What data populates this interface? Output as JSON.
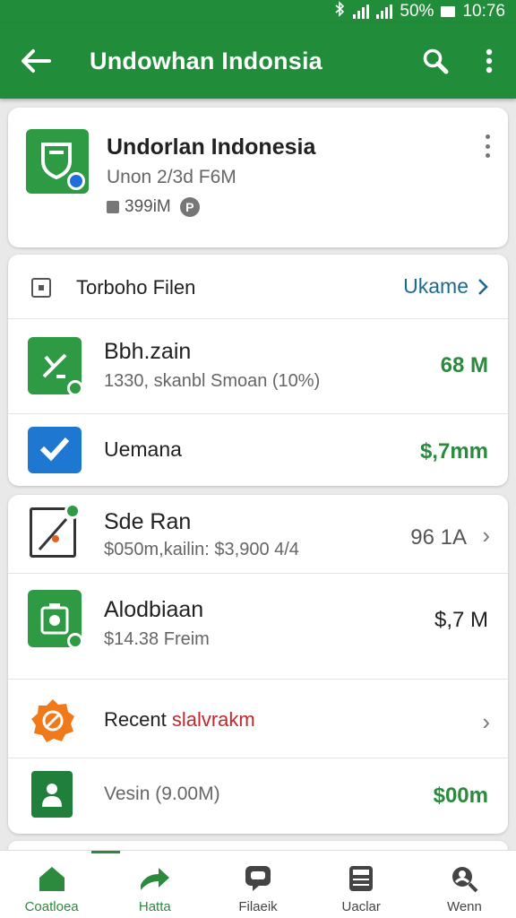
{
  "status_bar": {
    "battery": "50%",
    "time": "10:76"
  },
  "app_bar": {
    "title": "Undowhan Indonsia"
  },
  "app_card": {
    "name": "Undorlan Indonesia",
    "subtitle": "Unon 2/3d F6M",
    "size": "399iM",
    "size_badge": "P"
  },
  "section": {
    "header": {
      "title": "Torboho Filen",
      "link_label": "Ukame"
    },
    "items": [
      {
        "title": "Bbh.zain",
        "subtitle": "1330, skanbl Smoan (10%)",
        "value": "68 M"
      },
      {
        "title": "Uemana",
        "subtitle": "",
        "value": "$,7mm"
      }
    ]
  },
  "list": {
    "items": [
      {
        "title": "Sde Ran",
        "subtitle": "$050m,kailin: $3,900 4/4",
        "value": "96 1A"
      },
      {
        "title": "Alodbiaan",
        "subtitle": "$14.38 Freim",
        "value": "$,7 M"
      },
      {
        "title_prefix": "Recent ",
        "title_accent": "slalvrakm"
      },
      {
        "title": "Vesin (9.00M)",
        "value": "$00m"
      }
    ]
  },
  "bottom_nav": {
    "items": [
      {
        "label": "Coatloea",
        "icon": "home-icon"
      },
      {
        "label": "Hatta",
        "icon": "share-arrow-icon"
      },
      {
        "label": "Filaeik",
        "icon": "chat-icon"
      },
      {
        "label": "Uaclar",
        "icon": "calculator-icon"
      },
      {
        "label": "Wenn",
        "icon": "profile-search-icon"
      }
    ]
  },
  "colors": {
    "primary": "#218c3a",
    "value_green": "#2b8a3e",
    "link_blue": "#1d6a8f",
    "accent_red": "#c0282b",
    "tile_blue": "#1e78d2",
    "tile_orange": "#f07a1a"
  }
}
